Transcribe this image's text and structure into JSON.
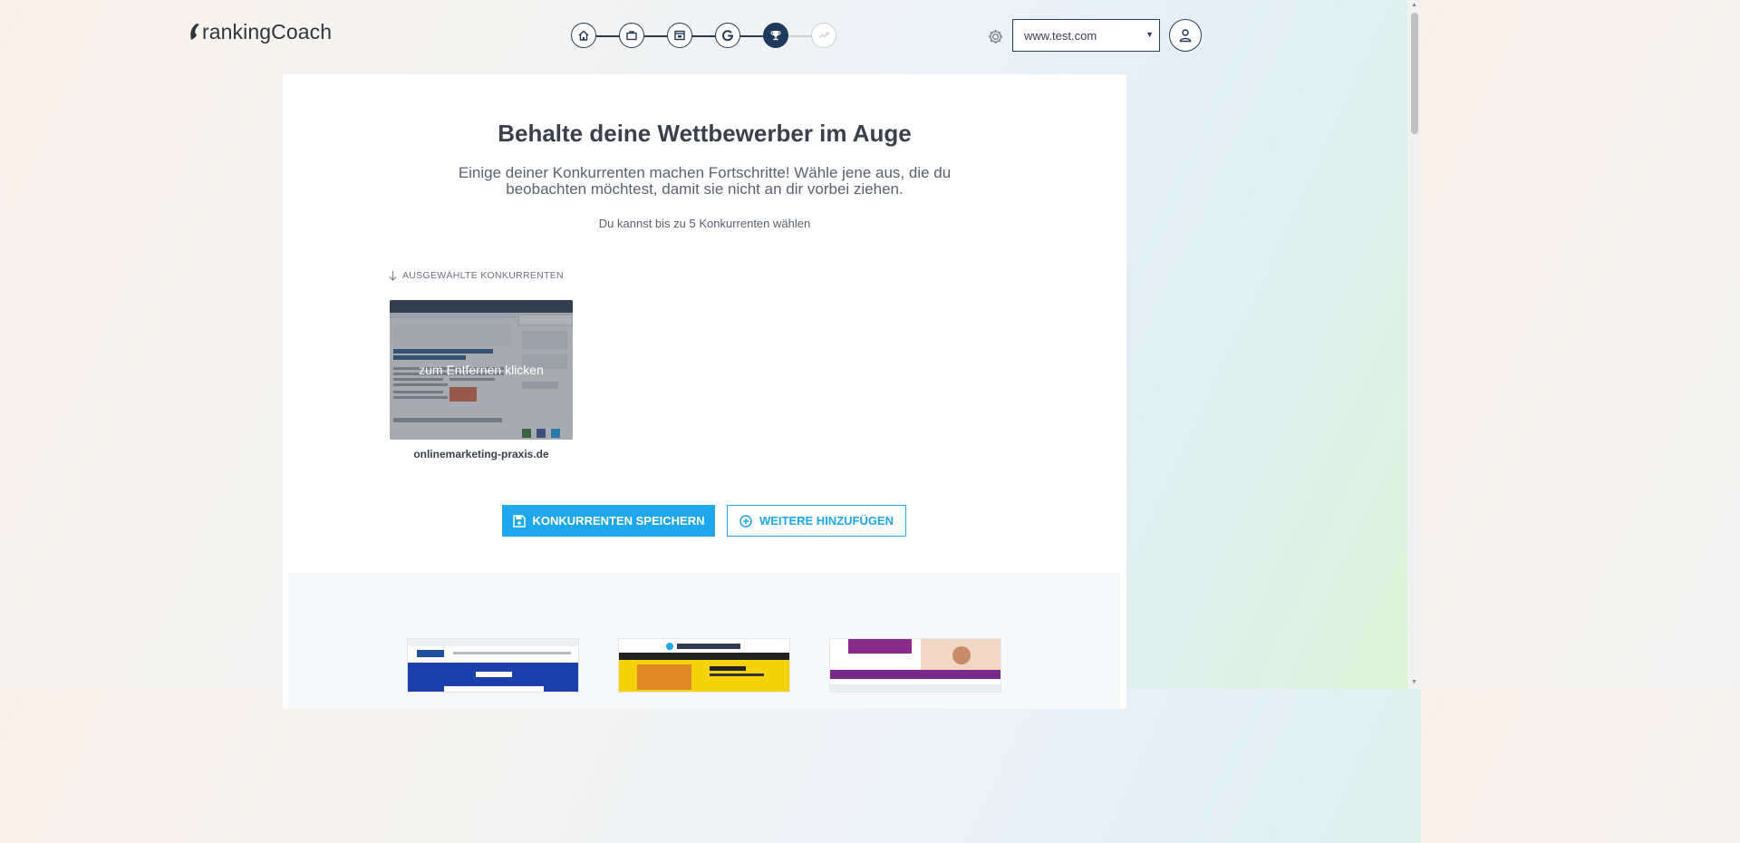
{
  "header": {
    "logo_text": "rankingCoach",
    "site_select_value": "www.test.com",
    "steps": [
      {
        "icon": "home-icon",
        "state": "done"
      },
      {
        "icon": "briefcase-icon",
        "state": "done"
      },
      {
        "icon": "browser-icon",
        "state": "done"
      },
      {
        "icon": "google-icon",
        "state": "done"
      },
      {
        "icon": "trophy-icon",
        "state": "active"
      },
      {
        "icon": "trend-icon",
        "state": "future"
      }
    ]
  },
  "main": {
    "title": "Behalte deine Wettbewerber im Auge",
    "subtitle": "Einige deiner Konkurrenten machen Fortschritte! Wähle jene aus, die du beobachten möchtest, damit sie nicht an dir vorbei ziehen.",
    "hint": "Du kannst bis zu 5 Konkurrenten wählen",
    "section_label": "AUSGEWÄHLTE KONKURRENTEN",
    "selected": [
      {
        "name": "onlinemarketing-praxis.de",
        "overlay": "zum Entfernen klicken"
      }
    ],
    "save_button": "KONKURRENTEN SPEICHERN",
    "add_button": "WEITERE HINZUFÜGEN"
  },
  "colors": {
    "accent": "#1ea7ec",
    "navy": "#1f3a5a"
  }
}
